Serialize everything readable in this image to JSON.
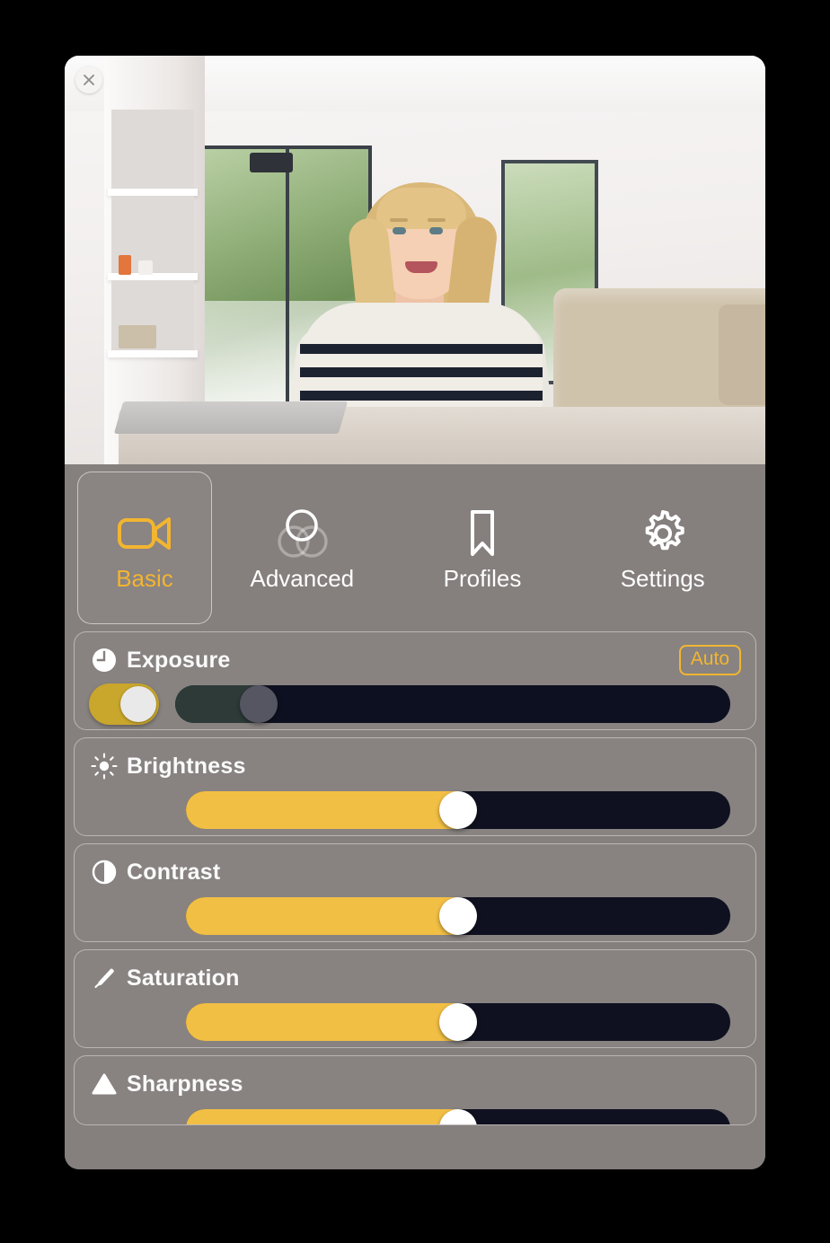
{
  "window": {
    "close_label": "Close",
    "close_icon": "close-icon"
  },
  "preview": {
    "name": "camera-preview",
    "description": "Live camera preview of a smiling blonde woman in a striped shirt seated at a table in a bright living room"
  },
  "tabs": [
    {
      "id": "basic",
      "label": "Basic",
      "icon": "video-camera-icon",
      "selected": true
    },
    {
      "id": "advanced",
      "label": "Advanced",
      "icon": "venn-circles-icon",
      "selected": false
    },
    {
      "id": "profiles",
      "label": "Profiles",
      "icon": "bookmark-icon",
      "selected": false
    },
    {
      "id": "settings",
      "label": "Settings",
      "icon": "gear-icon",
      "selected": false
    }
  ],
  "controls": [
    {
      "id": "exposure",
      "label": "Exposure",
      "icon": "clock-icon",
      "auto_label": "Auto",
      "auto_enabled": true,
      "toggle_on": true,
      "slider_disabled": true,
      "value_percent": 15
    },
    {
      "id": "brightness",
      "label": "Brightness",
      "icon": "sun-icon",
      "slider_disabled": false,
      "value_percent": 50
    },
    {
      "id": "contrast",
      "label": "Contrast",
      "icon": "half-circle-icon",
      "slider_disabled": false,
      "value_percent": 50
    },
    {
      "id": "saturation",
      "label": "Saturation",
      "icon": "eyedropper-icon",
      "slider_disabled": false,
      "value_percent": 50
    },
    {
      "id": "sharpness",
      "label": "Sharpness",
      "icon": "triangle-icon",
      "slider_disabled": false,
      "value_percent": 50
    }
  ],
  "colors": {
    "accent": "#f2b530",
    "slider_fill": "#f2bf45",
    "track": "#0f1120",
    "panel_bg": "#857f7d",
    "toggle_on": "#c9a62c",
    "text": "#fafafa"
  }
}
